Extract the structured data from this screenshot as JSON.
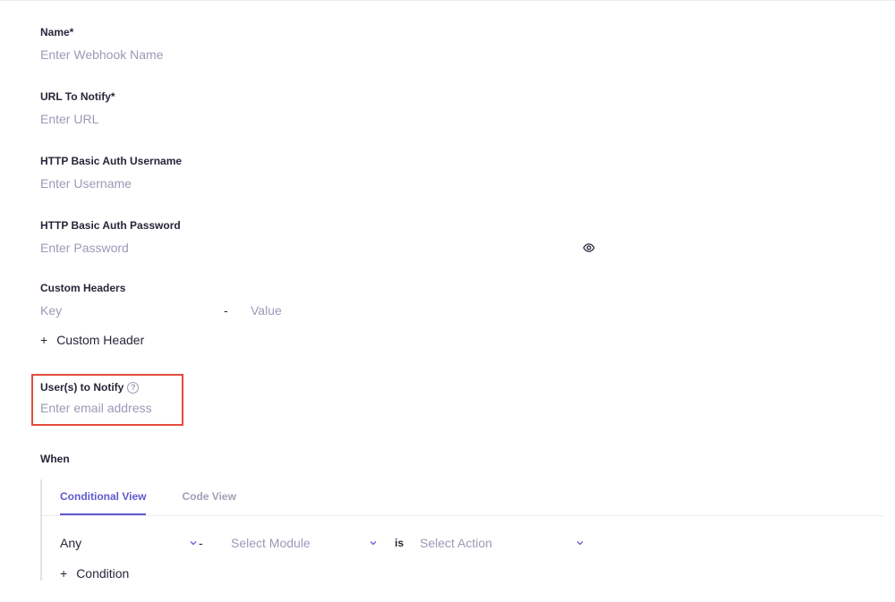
{
  "fields": {
    "name": {
      "label": "Name*",
      "placeholder": "Enter Webhook Name"
    },
    "url": {
      "label": "URL To Notify*",
      "placeholder": "Enter URL"
    },
    "username": {
      "label": "HTTP Basic Auth Username",
      "placeholder": "Enter Username"
    },
    "password": {
      "label": "HTTP Basic Auth Password",
      "placeholder": "Enter Password"
    },
    "custom_headers": {
      "label": "Custom Headers",
      "key_placeholder": "Key",
      "value_placeholder": "Value",
      "dash": "-",
      "add_label": "Custom Header"
    },
    "users_notify": {
      "label": "User(s) to Notify",
      "placeholder": "Enter email address"
    }
  },
  "when": {
    "label": "When",
    "tabs": {
      "conditional": "Conditional View",
      "code": "Code View"
    },
    "condition": {
      "any": "Any",
      "dash": "-",
      "module_placeholder": "Select Module",
      "is": "is",
      "action_placeholder": "Select Action"
    },
    "add_condition": "Condition"
  },
  "icons": {
    "plus": "+",
    "help": "?"
  }
}
